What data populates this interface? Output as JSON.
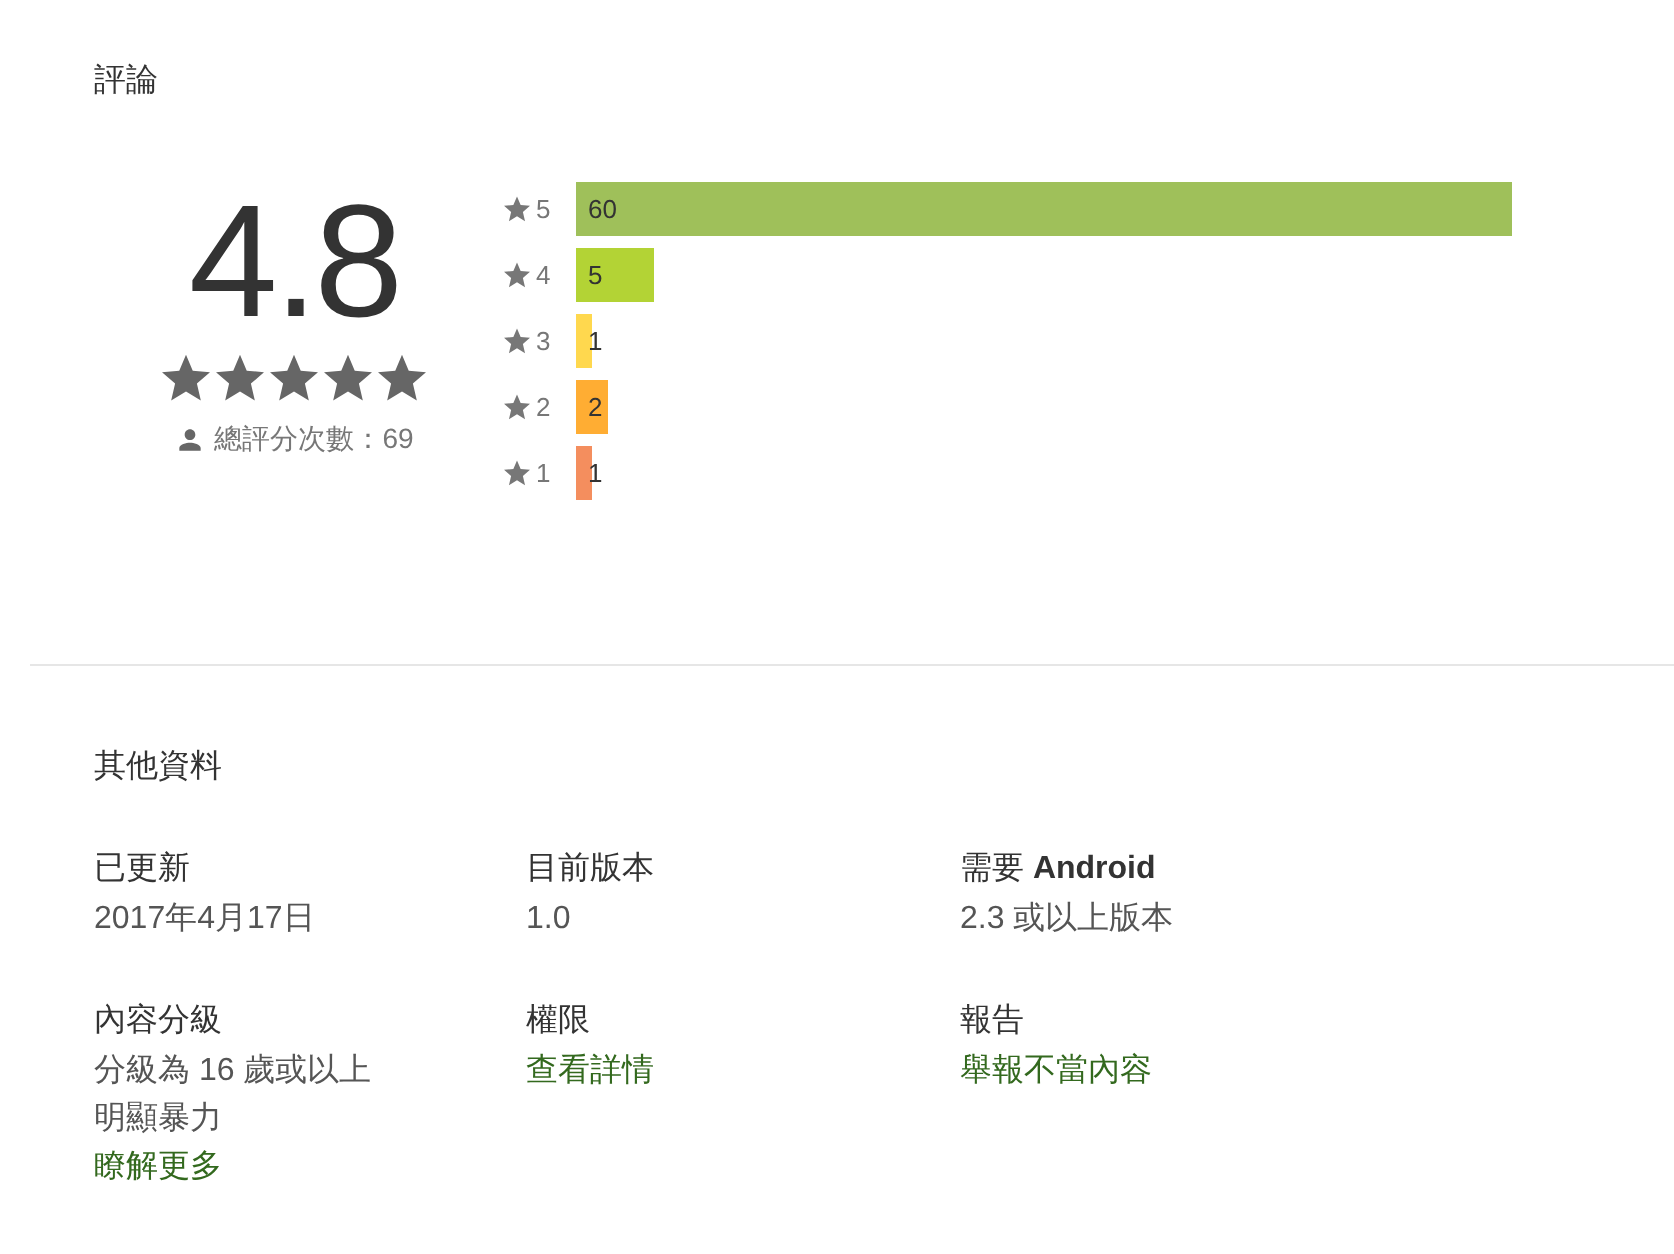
{
  "reviews": {
    "title": "評論",
    "score": "4.8",
    "stars": 5,
    "total": "總評分次數：69",
    "histogram": [
      {
        "rating": "5",
        "count": "60",
        "color": "#9fc05a"
      },
      {
        "rating": "4",
        "count": "5",
        "color": "#b3d335"
      },
      {
        "rating": "3",
        "count": "1",
        "color": "#ffd84e"
      },
      {
        "rating": "2",
        "count": "2",
        "color": "#ffad33"
      },
      {
        "rating": "1",
        "count": "1",
        "color": "#f48e5e"
      }
    ]
  },
  "additional_info": {
    "title": "其他資料",
    "items": [
      {
        "label": "已更新",
        "lines": [
          {
            "text": "2017年4月17日",
            "kind": "text"
          }
        ]
      },
      {
        "label": "目前版本",
        "lines": [
          {
            "text": "1.0",
            "kind": "text"
          }
        ]
      },
      {
        "label": "需要 **Android**",
        "lines": [
          {
            "text": "2.3 或以上版本",
            "kind": "text"
          }
        ]
      },
      {
        "label": "內容分級",
        "lines": [
          {
            "text": "分級為 16 歲或以上",
            "kind": "text"
          },
          {
            "text": "明顯暴力",
            "kind": "text"
          },
          {
            "text": "瞭解更多",
            "kind": "link"
          }
        ]
      },
      {
        "label": "權限",
        "lines": [
          {
            "text": "查看詳情",
            "kind": "link"
          }
        ]
      },
      {
        "label": "報告",
        "lines": [
          {
            "text": "舉報不當內容",
            "kind": "link"
          }
        ]
      }
    ]
  }
}
